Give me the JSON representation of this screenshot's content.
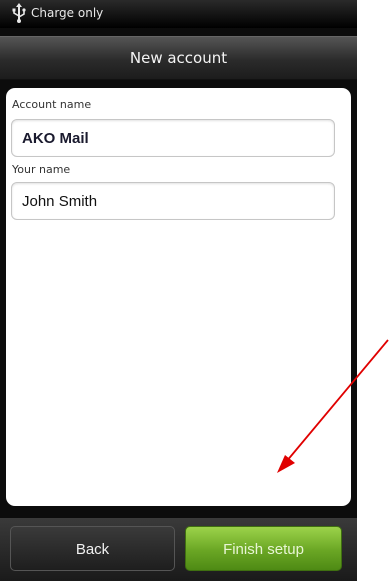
{
  "status_bar": {
    "icon": "usb-icon",
    "text": "Charge only"
  },
  "title_bar": {
    "title": "New account"
  },
  "form": {
    "account_name": {
      "label": "Account name",
      "value": "AKO Mail"
    },
    "your_name": {
      "label": "Your name",
      "value": "John Smith"
    }
  },
  "buttons": {
    "back": "Back",
    "finish": "Finish setup"
  },
  "annotation": {
    "icon": "red-arrow",
    "color": "#e00000"
  }
}
